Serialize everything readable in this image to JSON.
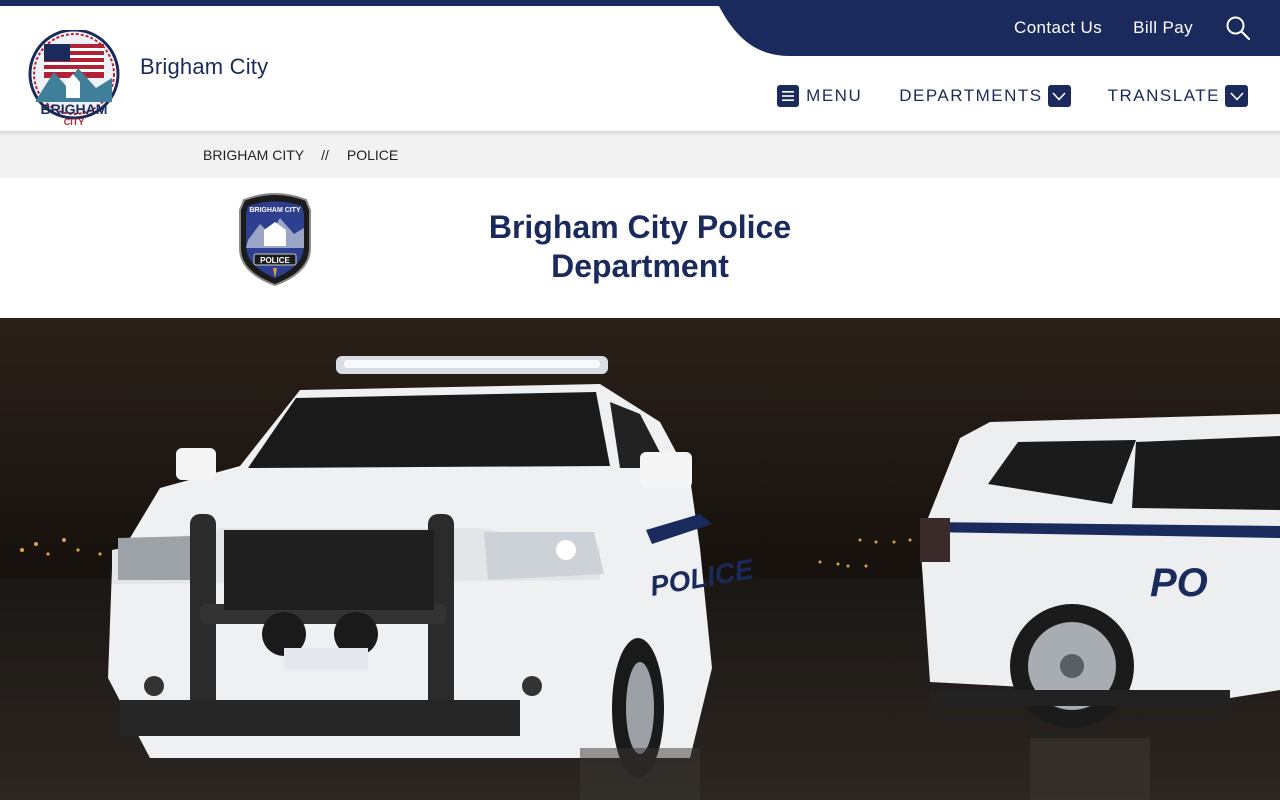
{
  "utility_nav": {
    "links": [
      "Contact Us",
      "Bill Pay"
    ],
    "search_icon": "search-icon"
  },
  "site": {
    "title": "Brigham City",
    "logo_text": "BRIGHAM",
    "logo_subtext": "CITY"
  },
  "main_nav": {
    "menu_label": "MENU",
    "departments_label": "DEPARTMENTS",
    "translate_label": "TRANSLATE"
  },
  "breadcrumb": {
    "items": [
      "BRIGHAM CITY",
      "POLICE"
    ],
    "separator": "//"
  },
  "page": {
    "title_line1": "Brigham City Police",
    "title_line2": "Department",
    "badge_text": "POLICE",
    "badge_top_text": "BRIGHAM CITY"
  },
  "hero": {
    "left_vehicle_text": "POLICE",
    "right_vehicle_text": "PO"
  },
  "colors": {
    "brand_navy": "#1b2a5c",
    "breadcrumb_bg": "#f2f2f2",
    "logo_red": "#b22234"
  }
}
